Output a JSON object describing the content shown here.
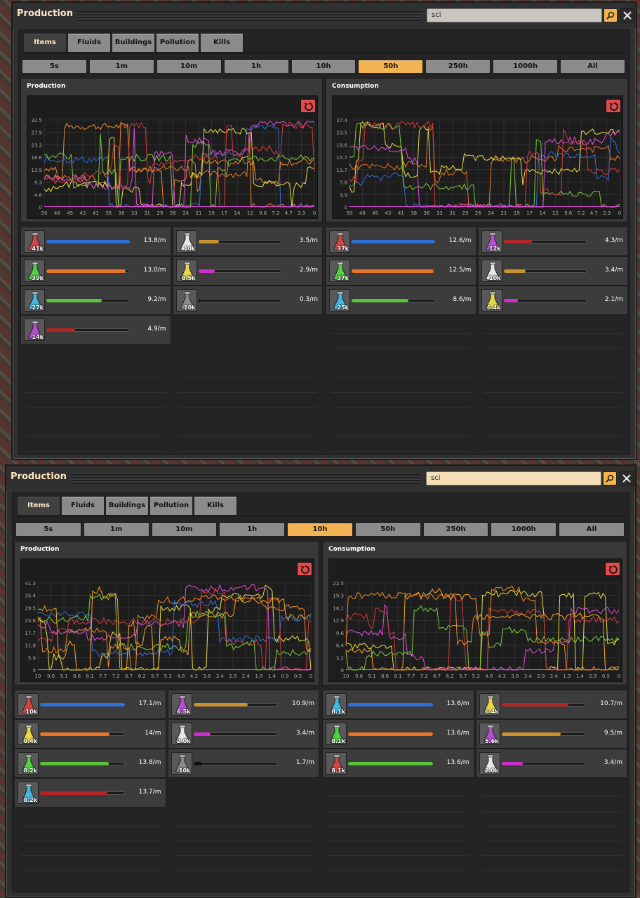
{
  "windows": [
    {
      "title": "Production",
      "search_value": "sci",
      "tabs": [
        {
          "label": "Items",
          "active": true
        },
        {
          "label": "Fluids"
        },
        {
          "label": "Buildings"
        },
        {
          "label": "Pollution"
        },
        {
          "label": "Kills"
        }
      ],
      "timescales": [
        {
          "label": "5s"
        },
        {
          "label": "1m"
        },
        {
          "label": "10m"
        },
        {
          "label": "1h"
        },
        {
          "label": "10h"
        },
        {
          "label": "50h",
          "active": true
        },
        {
          "label": "250h"
        },
        {
          "label": "1000h"
        },
        {
          "label": "All"
        }
      ],
      "production": {
        "label": "Production",
        "yticks": [
          "32.5",
          "27.9",
          "23.2",
          "18.6",
          "13.9",
          "9.3",
          "4.6",
          "0"
        ],
        "xticks": [
          "50",
          "48",
          "45",
          "43",
          "41",
          "38",
          "36",
          "33",
          "31",
          "29",
          "26",
          "24",
          "21",
          "19",
          "17",
          "14",
          "12",
          "9.6",
          "7.2",
          "4.7",
          "2.3",
          "0"
        ],
        "items": [
          {
            "color": "#d04545",
            "count": "41k",
            "rate": "13.8/m",
            "bar_color": "#2f6fd6",
            "level": 1.0
          },
          {
            "color": "#4fd145",
            "count": "39k",
            "rate": "13.0/m",
            "bar_color": "#e8742a",
            "level": 0.95
          },
          {
            "color": "#45b8e0",
            "count": "27k",
            "rate": "9.2/m",
            "bar_color": "#5cc23a",
            "level": 0.67
          },
          {
            "color": "#b44fd1",
            "count": "14k",
            "rate": "4.9/m",
            "bar_color": "#b52525",
            "level": 0.35
          },
          {
            "color": "#e8e8e8",
            "count": "10k",
            "rate": "3.5/m",
            "bar_color": "#c9922f",
            "level": 0.25
          },
          {
            "color": "#e8d845",
            "count": "8.5k",
            "rate": "2.9/m",
            "bar_color": "#cc2fcc",
            "level": 0.2
          },
          {
            "color": "#8a8a8a",
            "count": "10k",
            "rate": "0.3/m",
            "bar_color": "#111111",
            "level": 0.02
          }
        ]
      },
      "consumption": {
        "label": "Consumption",
        "yticks": [
          "27.4",
          "23.5",
          "19.6",
          "15.7",
          "11.7",
          "7.8",
          "3.9",
          "0"
        ],
        "xticks": [
          "50",
          "48",
          "45",
          "43",
          "41",
          "38",
          "36",
          "33",
          "31",
          "29",
          "26",
          "24",
          "21",
          "19",
          "17",
          "14",
          "12",
          "9.6",
          "7.2",
          "4.7",
          "2.3",
          "0"
        ],
        "items": [
          {
            "color": "#d04545",
            "count": "37k",
            "rate": "12.6/m",
            "bar_color": "#2f6fd6",
            "level": 1.0
          },
          {
            "color": "#4fd145",
            "count": "37k",
            "rate": "12.5/m",
            "bar_color": "#e8742a",
            "level": 0.99
          },
          {
            "color": "#45b8e0",
            "count": "25k",
            "rate": "8.6/m",
            "bar_color": "#5cc23a",
            "level": 0.68
          },
          {
            "color": "#b44fd1",
            "count": "12k",
            "rate": "4.3/m",
            "bar_color": "#b52525",
            "level": 0.34
          },
          {
            "color": "#e8e8e8",
            "count": "10k",
            "rate": "3.4/m",
            "bar_color": "#c9922f",
            "level": 0.27
          },
          {
            "color": "#e8d845",
            "count": "6.4k",
            "rate": "2.1/m",
            "bar_color": "#cc2fcc",
            "level": 0.17
          }
        ]
      }
    },
    {
      "title": "Production",
      "search_value": "sci",
      "tabs": [
        {
          "label": "Items",
          "active": true
        },
        {
          "label": "Fluids"
        },
        {
          "label": "Buildings"
        },
        {
          "label": "Pollution"
        },
        {
          "label": "Kills"
        }
      ],
      "timescales": [
        {
          "label": "5s"
        },
        {
          "label": "1m"
        },
        {
          "label": "10m"
        },
        {
          "label": "1h"
        },
        {
          "label": "10h",
          "active": true
        },
        {
          "label": "50h"
        },
        {
          "label": "250h"
        },
        {
          "label": "1000h"
        },
        {
          "label": "All"
        }
      ],
      "production": {
        "label": "Production",
        "yticks": [
          "41.3",
          "35.4",
          "29.5",
          "23.6",
          "17.7",
          "11.8",
          "5.9",
          "0"
        ],
        "xticks": [
          "10",
          "9.6",
          "9.1",
          "8.6",
          "8.1",
          "7.7",
          "7.2",
          "6.7",
          "6.2",
          "5.7",
          "5.3",
          "4.8",
          "4.3",
          "3.8",
          "3.4",
          "2.9",
          "2.4",
          "1.9",
          "1.4",
          "0.9",
          "0.5",
          "0"
        ],
        "items": [
          {
            "color": "#d04545",
            "count": "10k",
            "rate": "17.1/m",
            "bar_color": "#2f6fd6",
            "level": 1.0
          },
          {
            "color": "#e8d845",
            "count": "8.4k",
            "rate": "14/m",
            "bar_color": "#e8742a",
            "level": 0.82
          },
          {
            "color": "#4fd145",
            "count": "8.2k",
            "rate": "13.8/m",
            "bar_color": "#5cc23a",
            "level": 0.81
          },
          {
            "color": "#45b8e0",
            "count": "8.2k",
            "rate": "13.7/m",
            "bar_color": "#b52525",
            "level": 0.8
          },
          {
            "color": "#b44fd1",
            "count": "6.5k",
            "rate": "10.9/m",
            "bar_color": "#c9922f",
            "level": 0.64
          },
          {
            "color": "#e8e8e8",
            "count": "2.0k",
            "rate": "3.4/m",
            "bar_color": "#cc2fcc",
            "level": 0.2
          },
          {
            "color": "#8a8a8a",
            "count": "10k",
            "rate": "1.7/m",
            "bar_color": "#111111",
            "level": 0.1
          }
        ]
      },
      "consumption": {
        "label": "Consumption",
        "yticks": [
          "22.5",
          "19.3",
          "16.1",
          "12.9",
          "9.6",
          "6.4",
          "3.2",
          "0"
        ],
        "xticks": [
          "10",
          "9.6",
          "9.1",
          "8.6",
          "8.1",
          "7.7",
          "7.2",
          "6.7",
          "6.2",
          "5.7",
          "5.3",
          "4.8",
          "4.3",
          "3.8",
          "3.4",
          "2.9",
          "2.4",
          "1.9",
          "1.4",
          "0.9",
          "0.5",
          "0"
        ],
        "items": [
          {
            "color": "#45b8e0",
            "count": "8.1k",
            "rate": "13.6/m",
            "bar_color": "#2f6fd6",
            "level": 1.0
          },
          {
            "color": "#4fd145",
            "count": "8.1k",
            "rate": "13.6/m",
            "bar_color": "#e8742a",
            "level": 1.0
          },
          {
            "color": "#d04545",
            "count": "8.1k",
            "rate": "13.6/m",
            "bar_color": "#5cc23a",
            "level": 1.0
          },
          {
            "color": "#e8d845",
            "count": "6.4k",
            "rate": "10.7/m",
            "bar_color": "#b52525",
            "level": 0.79
          },
          {
            "color": "#b44fd1",
            "count": "5.6k",
            "rate": "9.5/m",
            "bar_color": "#c9922f",
            "level": 0.7
          },
          {
            "color": "#e8e8e8",
            "count": "2.0k",
            "rate": "3.4/m",
            "bar_color": "#cc2fcc",
            "level": 0.25
          }
        ]
      }
    }
  ],
  "series_colors": [
    "#f08a2c",
    "#e8742a",
    "#2f6fd6",
    "#e6df40",
    "#7acb3a",
    "#e04cd8",
    "#d83a3a",
    "#f5a623"
  ]
}
